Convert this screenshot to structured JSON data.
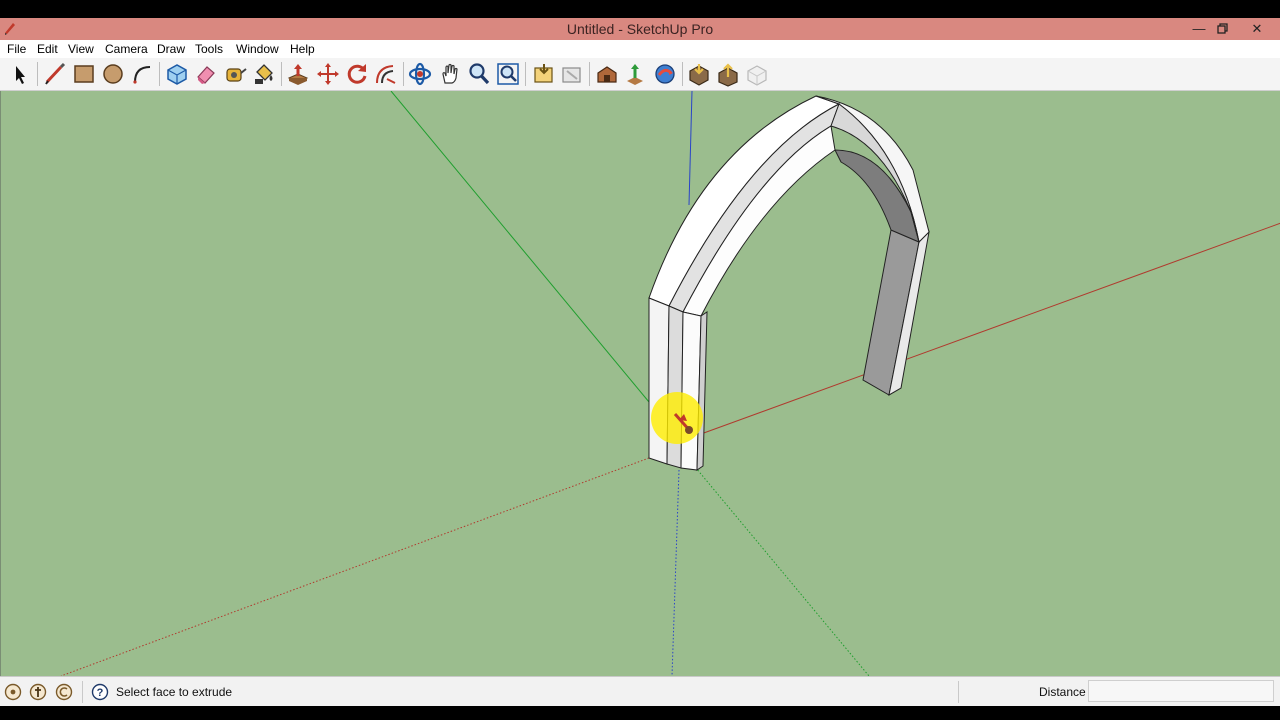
{
  "window": {
    "title": "Untitled - SketchUp Pro",
    "controls": [
      "minimize-icon",
      "restore-icon",
      "close-icon"
    ]
  },
  "menu": {
    "items": [
      "File",
      "Edit",
      "View",
      "Camera",
      "Draw",
      "Tools",
      "Window",
      "Help"
    ]
  },
  "toolbar": {
    "tools": [
      "select-icon",
      "line-icon",
      "rectangle-icon",
      "circle-icon",
      "arc-icon",
      "make-component-icon",
      "eraser-icon",
      "tape-measure-icon",
      "paint-bucket-icon",
      "push-pull-icon",
      "move-icon",
      "rotate-icon",
      "offset-icon",
      "orbit-icon",
      "pan-icon",
      "zoom-icon",
      "zoom-extents-icon",
      "previous-view-icon",
      "next-view-icon",
      "warehouse-icon",
      "share-model-icon",
      "extension-warehouse-icon",
      "get-models-icon",
      "share-component-icon",
      "layout-icon"
    ]
  },
  "canvas": {
    "colors": {
      "background": "#9bbd8e",
      "red_axis": "#b03a2e",
      "green_axis": "#1f9e2e",
      "blue_axis": "#2a44c8"
    },
    "cursor": "push-pull-icon",
    "highlight_color": "#ffee00"
  },
  "status": {
    "message": "Select face to extrude",
    "vcb_label": "Distance",
    "vcb_value": "",
    "icons": [
      "geo-location-icon",
      "credits-icon",
      "login-icon",
      "help-icon"
    ]
  }
}
